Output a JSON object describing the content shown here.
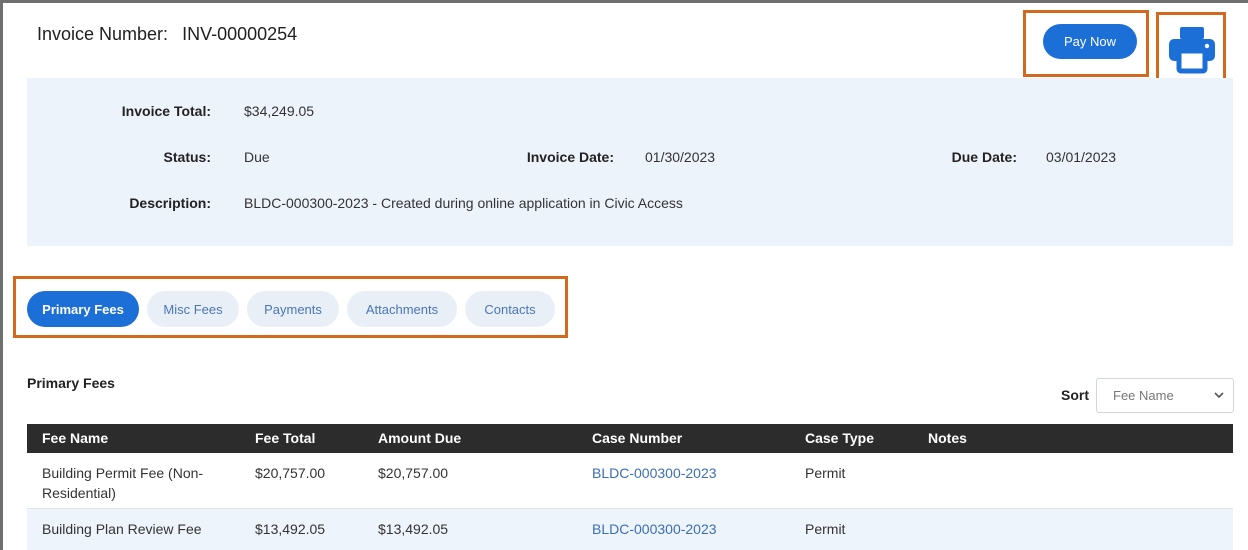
{
  "header": {
    "invoice_label": "Invoice Number:",
    "invoice_number": "INV-00000254",
    "pay_button": "Pay Now",
    "print_icon": "printer-icon"
  },
  "summary": {
    "total_label": "Invoice Total:",
    "total_value": "$34,249.05",
    "status_label": "Status:",
    "status_value": "Due",
    "invoice_date_label": "Invoice Date:",
    "invoice_date_value": "01/30/2023",
    "due_date_label": "Due Date:",
    "due_date_value": "03/01/2023",
    "description_label": "Description:",
    "description_value": "BLDC-000300-2023 - Created during online application in Civic Access"
  },
  "tabs": [
    {
      "label": "Primary Fees",
      "active": true
    },
    {
      "label": "Misc Fees",
      "active": false
    },
    {
      "label": "Payments",
      "active": false
    },
    {
      "label": "Attachments",
      "active": false
    },
    {
      "label": "Contacts",
      "active": false
    }
  ],
  "section": {
    "title": "Primary Fees",
    "sort_label": "Sort",
    "sort_value": "Fee Name"
  },
  "table": {
    "columns": [
      "Fee Name",
      "Fee Total",
      "Amount Due",
      "Case Number",
      "Case Type",
      "Notes"
    ],
    "rows": [
      {
        "fee_name": "Building Permit Fee (Non-Residential)",
        "fee_total": "$20,757.00",
        "amount_due": "$20,757.00",
        "case_number": "BLDC-000300-2023",
        "case_type": "Permit",
        "notes": ""
      },
      {
        "fee_name": "Building Plan Review Fee",
        "fee_total": "$13,492.05",
        "amount_due": "$13,492.05",
        "case_number": "BLDC-000300-2023",
        "case_type": "Permit",
        "notes": ""
      }
    ]
  },
  "colors": {
    "accent": "#1d6fd8",
    "highlight": "#d2691e",
    "panel": "#edf3fb",
    "table_header": "#2c2c2c"
  }
}
